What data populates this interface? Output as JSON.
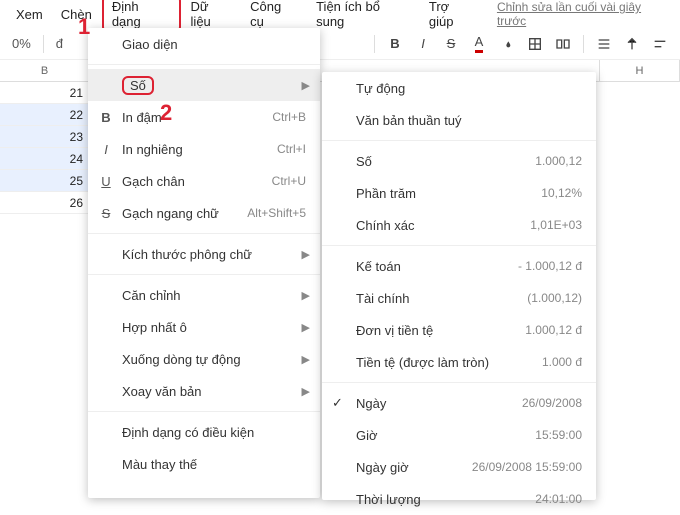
{
  "menubar": {
    "items": [
      "Xem",
      "Chèn",
      "Định dạng",
      "Dữ liệu",
      "Công cụ",
      "Tiện ích bổ sung",
      "Trợ giúp"
    ],
    "lastEdit": "Chỉnh sửa lần cuối vài giây trước",
    "highlightedIndex": 2
  },
  "markers": {
    "one": "1",
    "two": "2"
  },
  "toolbar": {
    "percent": "0%",
    "currency": "đ"
  },
  "columns": {
    "B": "B",
    "H": "H"
  },
  "cells": [
    "21",
    "22",
    "23",
    "24",
    "25",
    "26"
  ],
  "formatMenu": {
    "giaoDien": "Giao diện",
    "so": "Số",
    "inDam": {
      "label": "In đậm",
      "kbd": "Ctrl+B"
    },
    "inNghieng": {
      "label": "In nghiêng",
      "kbd": "Ctrl+I"
    },
    "gachChan": {
      "label": "Gạch chân",
      "kbd": "Ctrl+U"
    },
    "gachNgang": {
      "label": "Gạch ngang chữ",
      "kbd": "Alt+Shift+5"
    },
    "kichThuoc": "Kích thước phông chữ",
    "canChinh": "Căn chỉnh",
    "hopNhat": "Hợp nhất ô",
    "xuongDong": "Xuống dòng tự động",
    "xoayVanBan": "Xoay văn bản",
    "dinhDangDK": "Định dạng có điều kiện",
    "mauThayThe": "Màu thay thế"
  },
  "numberMenu": {
    "tuDong": "Tự động",
    "vanBan": "Văn bản thuần tuý",
    "so": {
      "label": "Số",
      "val": "1.000,12"
    },
    "phanTram": {
      "label": "Phần trăm",
      "val": "10,12%"
    },
    "chinhXac": {
      "label": "Chính xác",
      "val": "1,01E+03"
    },
    "keToan": {
      "label": "Kế toán",
      "val": "- 1.000,12 đ"
    },
    "taiChinh": {
      "label": "Tài chính",
      "val": "(1.000,12)"
    },
    "donViTienTe": {
      "label": "Đơn vị tiền tệ",
      "val": "1.000,12 đ"
    },
    "tienTeLamTron": {
      "label": "Tiền tệ (được làm tròn)",
      "val": "1.000 đ"
    },
    "ngay": {
      "label": "Ngày",
      "val": "26/09/2008"
    },
    "gio": {
      "label": "Giờ",
      "val": "15:59:00"
    },
    "ngayGio": {
      "label": "Ngày giờ",
      "val": "26/09/2008 15:59:00"
    },
    "thoiLuong": {
      "label": "Thời lượng",
      "val": "24:01:00"
    }
  }
}
